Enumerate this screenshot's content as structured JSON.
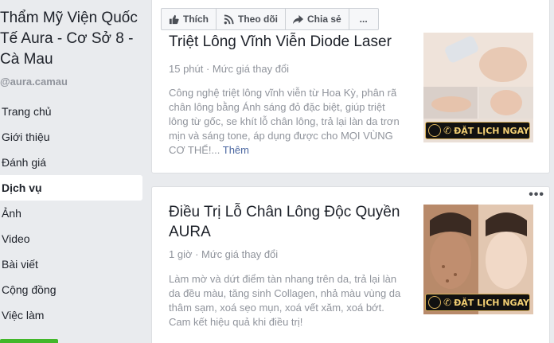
{
  "page": {
    "name": "Thẩm Mỹ Viện Quốc Tế Aura - Cơ Sở 8 - Cà Mau",
    "handle": "@aura.camau"
  },
  "nav": {
    "items": [
      {
        "label": "Trang chủ"
      },
      {
        "label": "Giới thiệu"
      },
      {
        "label": "Đánh giá"
      },
      {
        "label": "Dịch vụ",
        "active": true
      },
      {
        "label": "Ảnh"
      },
      {
        "label": "Video"
      },
      {
        "label": "Bài viết"
      },
      {
        "label": "Cộng đồng"
      },
      {
        "label": "Việc làm"
      }
    ]
  },
  "actions": {
    "like": "Thích",
    "follow": "Theo dõi",
    "share": "Chia sẻ",
    "more": "..."
  },
  "services": [
    {
      "title": "Triệt Lông Vĩnh Viễn Diode Laser",
      "meta": "15 phút · Mức giá thay đổi",
      "description": "Công nghệ triệt lông vĩnh viễn từ Hoa Kỳ, phân rã chân lông bằng Ánh sáng đỏ đặc biệt, giúp triệt lông từ gốc, se khít lỗ chân lông, trả lại làn da trơn mịn và sáng tone, áp dụng được cho MỌI VÙNG CƠ THỂ!...",
      "more_link": "Thêm",
      "badge": "ĐẶT LỊCH NGAY"
    },
    {
      "title": "Điều Trị Lỗ Chân Lông Độc Quyền AURA",
      "meta": "1 giờ · Mức giá thay đổi",
      "description": "Làm mờ và dứt điểm tàn nhang trên da, trả lại làn da đều màu, tăng sinh Collagen, nhả màu vùng da thâm sạm, xoá sẹo mụn, xoá vết xăm, xoá bớt. Cam kết hiệu quả khi điều trị!",
      "badge": "ĐẶT LỊCH NGAY",
      "menu": "•••"
    }
  ],
  "colors": {
    "background": "#e9ebee",
    "link": "#4b67a1",
    "muted_text": "#90949c",
    "badge_gold": "#f2cf73"
  }
}
